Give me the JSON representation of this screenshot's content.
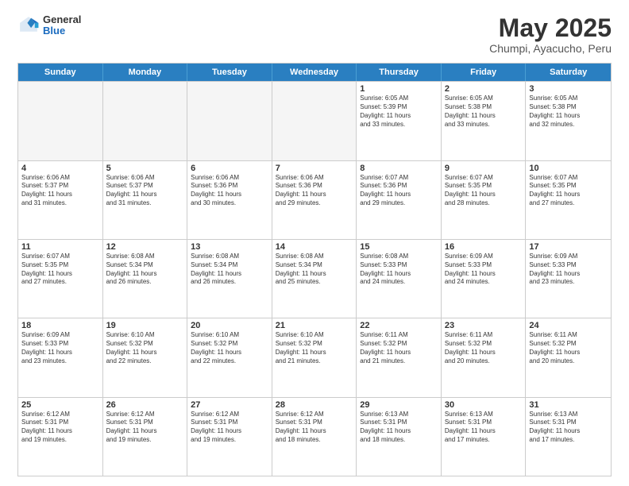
{
  "header": {
    "logo": {
      "general": "General",
      "blue": "Blue"
    },
    "title": "May 2025",
    "subtitle": "Chumpi, Ayacucho, Peru"
  },
  "calendar": {
    "days": [
      "Sunday",
      "Monday",
      "Tuesday",
      "Wednesday",
      "Thursday",
      "Friday",
      "Saturday"
    ],
    "rows": [
      [
        {
          "num": "",
          "text": "",
          "empty": true
        },
        {
          "num": "",
          "text": "",
          "empty": true
        },
        {
          "num": "",
          "text": "",
          "empty": true
        },
        {
          "num": "",
          "text": "",
          "empty": true
        },
        {
          "num": "1",
          "text": "Sunrise: 6:05 AM\nSunset: 5:39 PM\nDaylight: 11 hours\nand 33 minutes."
        },
        {
          "num": "2",
          "text": "Sunrise: 6:05 AM\nSunset: 5:38 PM\nDaylight: 11 hours\nand 33 minutes."
        },
        {
          "num": "3",
          "text": "Sunrise: 6:05 AM\nSunset: 5:38 PM\nDaylight: 11 hours\nand 32 minutes."
        }
      ],
      [
        {
          "num": "4",
          "text": "Sunrise: 6:06 AM\nSunset: 5:37 PM\nDaylight: 11 hours\nand 31 minutes."
        },
        {
          "num": "5",
          "text": "Sunrise: 6:06 AM\nSunset: 5:37 PM\nDaylight: 11 hours\nand 31 minutes."
        },
        {
          "num": "6",
          "text": "Sunrise: 6:06 AM\nSunset: 5:36 PM\nDaylight: 11 hours\nand 30 minutes."
        },
        {
          "num": "7",
          "text": "Sunrise: 6:06 AM\nSunset: 5:36 PM\nDaylight: 11 hours\nand 29 minutes."
        },
        {
          "num": "8",
          "text": "Sunrise: 6:07 AM\nSunset: 5:36 PM\nDaylight: 11 hours\nand 29 minutes."
        },
        {
          "num": "9",
          "text": "Sunrise: 6:07 AM\nSunset: 5:35 PM\nDaylight: 11 hours\nand 28 minutes."
        },
        {
          "num": "10",
          "text": "Sunrise: 6:07 AM\nSunset: 5:35 PM\nDaylight: 11 hours\nand 27 minutes."
        }
      ],
      [
        {
          "num": "11",
          "text": "Sunrise: 6:07 AM\nSunset: 5:35 PM\nDaylight: 11 hours\nand 27 minutes."
        },
        {
          "num": "12",
          "text": "Sunrise: 6:08 AM\nSunset: 5:34 PM\nDaylight: 11 hours\nand 26 minutes."
        },
        {
          "num": "13",
          "text": "Sunrise: 6:08 AM\nSunset: 5:34 PM\nDaylight: 11 hours\nand 26 minutes."
        },
        {
          "num": "14",
          "text": "Sunrise: 6:08 AM\nSunset: 5:34 PM\nDaylight: 11 hours\nand 25 minutes."
        },
        {
          "num": "15",
          "text": "Sunrise: 6:08 AM\nSunset: 5:33 PM\nDaylight: 11 hours\nand 24 minutes."
        },
        {
          "num": "16",
          "text": "Sunrise: 6:09 AM\nSunset: 5:33 PM\nDaylight: 11 hours\nand 24 minutes."
        },
        {
          "num": "17",
          "text": "Sunrise: 6:09 AM\nSunset: 5:33 PM\nDaylight: 11 hours\nand 23 minutes."
        }
      ],
      [
        {
          "num": "18",
          "text": "Sunrise: 6:09 AM\nSunset: 5:33 PM\nDaylight: 11 hours\nand 23 minutes."
        },
        {
          "num": "19",
          "text": "Sunrise: 6:10 AM\nSunset: 5:32 PM\nDaylight: 11 hours\nand 22 minutes."
        },
        {
          "num": "20",
          "text": "Sunrise: 6:10 AM\nSunset: 5:32 PM\nDaylight: 11 hours\nand 22 minutes."
        },
        {
          "num": "21",
          "text": "Sunrise: 6:10 AM\nSunset: 5:32 PM\nDaylight: 11 hours\nand 21 minutes."
        },
        {
          "num": "22",
          "text": "Sunrise: 6:11 AM\nSunset: 5:32 PM\nDaylight: 11 hours\nand 21 minutes."
        },
        {
          "num": "23",
          "text": "Sunrise: 6:11 AM\nSunset: 5:32 PM\nDaylight: 11 hours\nand 20 minutes."
        },
        {
          "num": "24",
          "text": "Sunrise: 6:11 AM\nSunset: 5:32 PM\nDaylight: 11 hours\nand 20 minutes."
        }
      ],
      [
        {
          "num": "25",
          "text": "Sunrise: 6:12 AM\nSunset: 5:31 PM\nDaylight: 11 hours\nand 19 minutes."
        },
        {
          "num": "26",
          "text": "Sunrise: 6:12 AM\nSunset: 5:31 PM\nDaylight: 11 hours\nand 19 minutes."
        },
        {
          "num": "27",
          "text": "Sunrise: 6:12 AM\nSunset: 5:31 PM\nDaylight: 11 hours\nand 19 minutes."
        },
        {
          "num": "28",
          "text": "Sunrise: 6:12 AM\nSunset: 5:31 PM\nDaylight: 11 hours\nand 18 minutes."
        },
        {
          "num": "29",
          "text": "Sunrise: 6:13 AM\nSunset: 5:31 PM\nDaylight: 11 hours\nand 18 minutes."
        },
        {
          "num": "30",
          "text": "Sunrise: 6:13 AM\nSunset: 5:31 PM\nDaylight: 11 hours\nand 17 minutes."
        },
        {
          "num": "31",
          "text": "Sunrise: 6:13 AM\nSunset: 5:31 PM\nDaylight: 11 hours\nand 17 minutes."
        }
      ]
    ]
  }
}
